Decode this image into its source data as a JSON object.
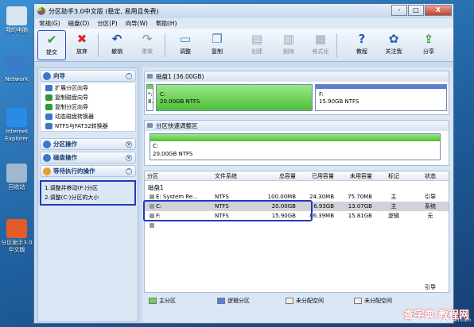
{
  "desktop": {
    "icons": [
      {
        "label": "我的电脑",
        "name": "my-computer"
      },
      {
        "label": "Network",
        "name": "network"
      },
      {
        "label": "Internet Explorer",
        "name": "internet-explorer"
      },
      {
        "label": "回收站",
        "name": "recycle-bin"
      },
      {
        "label": "分区助手3.0中文版",
        "name": "partition-assistant"
      }
    ]
  },
  "window": {
    "title": "分区助手3.0中文版 (稳定, 易用且免费)",
    "controls": [
      "-",
      "□",
      "X"
    ]
  },
  "menu": [
    "常规(G)",
    "磁盘(D)",
    "分区(P)",
    "向导(W)",
    "帮助(H)"
  ],
  "toolbar": [
    {
      "label": "提交",
      "icon": "checkmark-icon",
      "glyph": "✔",
      "color": "#2e9a31",
      "disabled": false,
      "selected": true
    },
    {
      "label": "放弃",
      "icon": "discard-icon",
      "glyph": "✖",
      "color": "#d22b2b",
      "disabled": false
    },
    {
      "label": "撤销",
      "icon": "undo-icon",
      "glyph": "↶",
      "color": "#1e4f9c",
      "disabled": false
    },
    {
      "label": "重做",
      "icon": "redo-icon",
      "glyph": "↷",
      "color": "#9aa6b5",
      "disabled": true
    },
    {
      "label": "调整",
      "icon": "resize-icon",
      "glyph": "▭",
      "color": "#4a7fc0",
      "disabled": false
    },
    {
      "label": "复制",
      "icon": "copy-icon",
      "glyph": "❐",
      "color": "#4a7fc0",
      "disabled": false
    },
    {
      "label": "创建",
      "icon": "create-icon",
      "glyph": "▤",
      "color": "#9aa6b5",
      "disabled": true
    },
    {
      "label": "删除",
      "icon": "delete-icon",
      "glyph": "▥",
      "color": "#9aa6b5",
      "disabled": true
    },
    {
      "label": "格式化",
      "icon": "format-icon",
      "glyph": "▦",
      "color": "#9aa6b5",
      "disabled": true
    },
    {
      "label": "教程",
      "icon": "tutorial-icon",
      "glyph": "?",
      "color": "#1e5fb8",
      "disabled": false
    },
    {
      "label": "关注我",
      "icon": "follow-icon",
      "glyph": "✿",
      "color": "#1e5fb8",
      "disabled": false
    },
    {
      "label": "分享",
      "icon": "share-icon",
      "glyph": "⇪",
      "color": "#2e9a31",
      "disabled": false
    }
  ],
  "sidebar": {
    "wizard": {
      "title": "向导",
      "items": [
        "扩展分区向导",
        "复制磁盘向导",
        "复制分区向导",
        "动态磁盘转换器",
        "NTFS与FAT32转换器"
      ]
    },
    "partition_ops": {
      "title": "分区操作"
    },
    "disk_ops": {
      "title": "磁盘操作"
    },
    "pending": {
      "title": "等待执行的操作",
      "items": [
        "1.调整并移动(F:)分区",
        "2.调整(C:)分区的大小"
      ]
    }
  },
  "disk1": {
    "header": "磁盘1 (36.00GB)",
    "segments": [
      {
        "letter": "*:",
        "size": "8.",
        "used": 0.0,
        "name": "star-segment"
      },
      {
        "letter": "C:",
        "size": "20.00GB NTFS",
        "used": 1.0,
        "name": "c-segment"
      },
      {
        "letter": "F:",
        "size": "15.90GB NTFS",
        "used": 0.01,
        "name": "f-segment"
      }
    ]
  },
  "quick_adjust": {
    "header": "分区快速调整区",
    "letter": "C:",
    "size": "20.00GB NTFS",
    "used": 1.0
  },
  "table": {
    "columns": [
      "分区",
      "文件系统",
      "总容量",
      "已用容量",
      "未用容量",
      "标记",
      "状态"
    ],
    "disk_label": "磁盘1",
    "rows": [
      {
        "cells": [
          "E: System Re...",
          "NTFS",
          "100.00MB",
          "24.30MB",
          "75.70MB",
          "主",
          "引导"
        ],
        "highlight": false
      },
      {
        "cells": [
          "C:",
          "NTFS",
          "20.00GB",
          "6.93GB",
          "13.07GB",
          "主",
          "系统"
        ],
        "highlight": true
      },
      {
        "cells": [
          "F:",
          "NTFS",
          "15.90GB",
          "86.39MB",
          "15.81GB",
          "逻辑",
          "无"
        ],
        "highlight": false
      }
    ],
    "trailing_status": "引导"
  },
  "legend": [
    {
      "label": "主分区",
      "color": "#6fd05a"
    },
    {
      "label": "逻辑分区",
      "color": "#5a7ed8"
    },
    {
      "label": "未分配空间",
      "color": "#f6eee2"
    },
    {
      "label": "未分配空间",
      "color": "#f6eee2"
    }
  ],
  "watermark": {
    "main": "查字典 教程网",
    "sub": "jiaocheng.chazidian.com"
  }
}
